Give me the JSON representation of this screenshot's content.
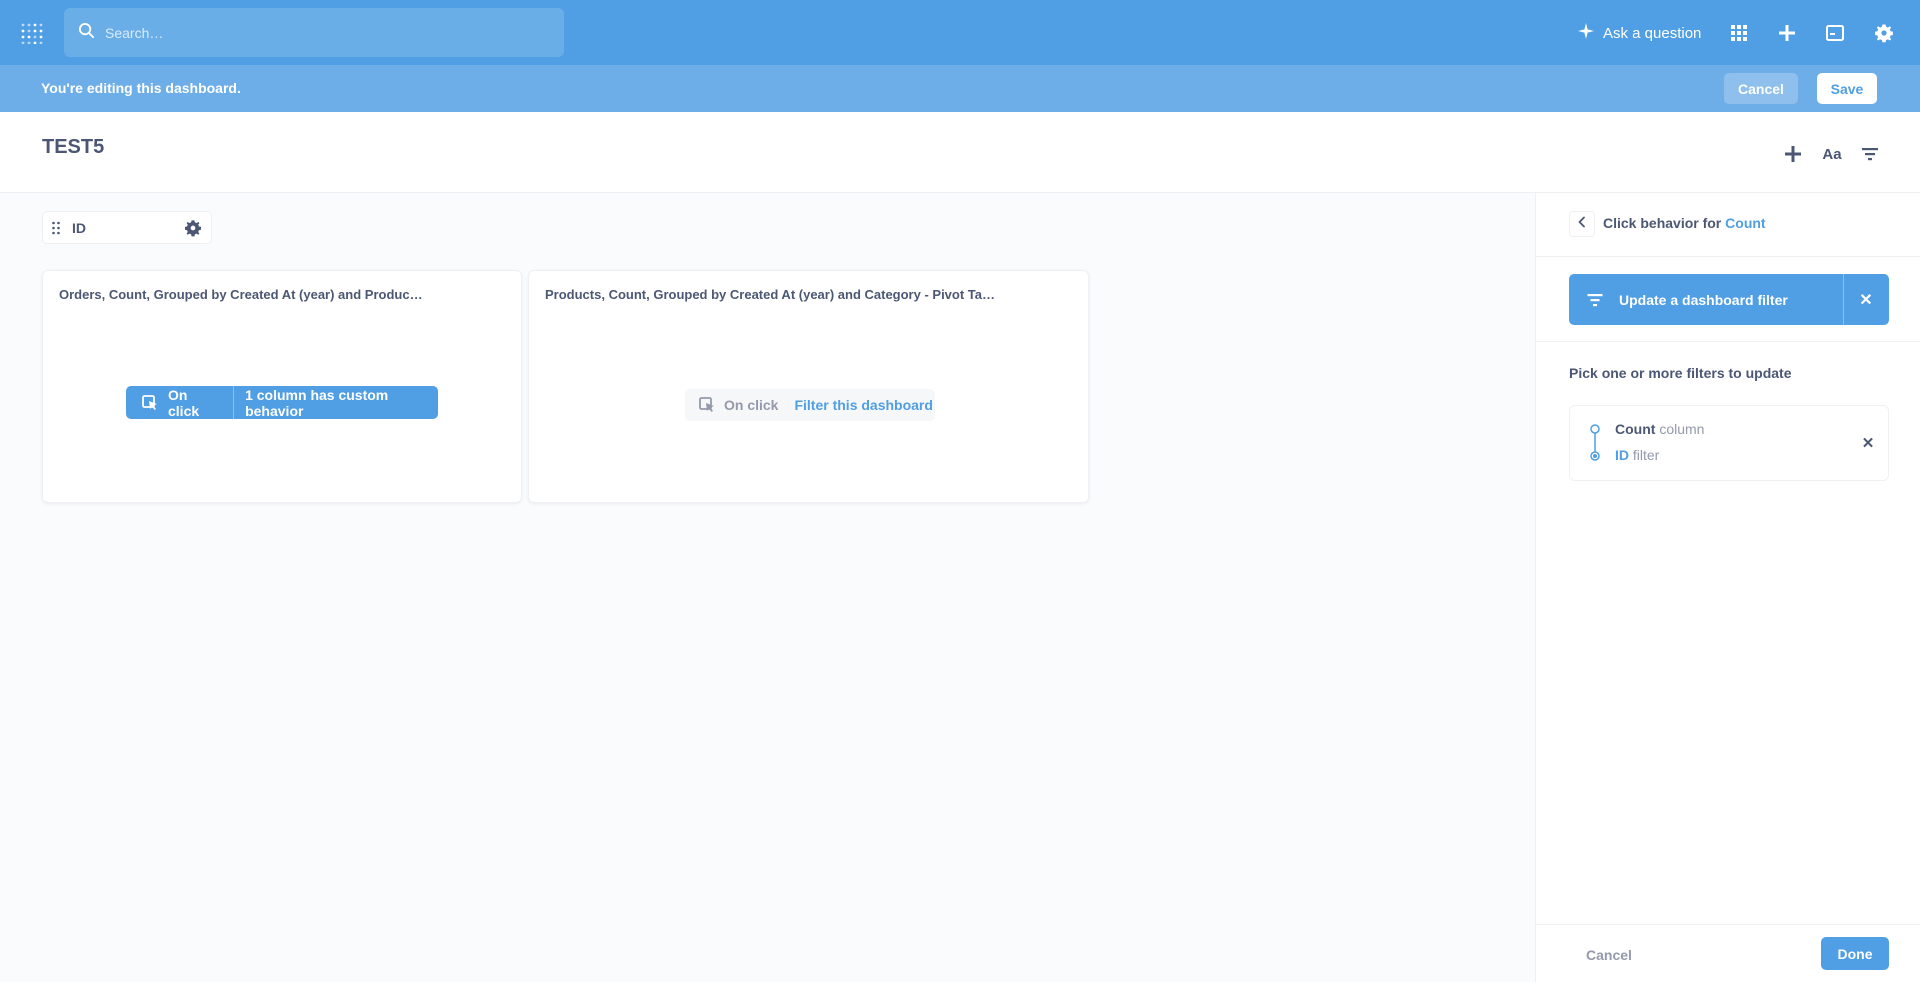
{
  "topnav": {
    "search_placeholder": "Search…",
    "ask_label": "Ask a question",
    "icons": [
      "logo-icon",
      "search-icon",
      "sparkle-icon",
      "grid-icon",
      "plus-icon",
      "terminal-icon",
      "gear-icon"
    ],
    "colors": {
      "bar": "#509ee3"
    }
  },
  "editbar": {
    "message": "You're editing this dashboard.",
    "cancel_label": "Cancel",
    "save_label": "Save"
  },
  "dashboard": {
    "title": "TEST5",
    "header_icons": [
      "add-icon",
      "text-icon",
      "filter-icon"
    ],
    "text_icon_label": "Aa"
  },
  "filter": {
    "label": "ID"
  },
  "cards": [
    {
      "title": "Orders, Count, Grouped by Created At (year) and Produc…",
      "click_label": "On click",
      "click_value": "1 column has custom behavior",
      "active": true
    },
    {
      "title": "Products, Count, Grouped by Created At (year) and Category - Pivot Ta…",
      "click_label": "On click",
      "click_value": "Filter this dashboard",
      "active": false
    }
  ],
  "sidebar": {
    "title_prefix": "Click behavior for",
    "title_column": "Count",
    "action_label": "Update a dashboard filter",
    "pick_label": "Pick one or more filters to update",
    "mapping": {
      "source_name": "Count",
      "source_type": "column",
      "target_name": "ID",
      "target_type": "filter"
    },
    "cancel_label": "Cancel",
    "done_label": "Done"
  },
  "colors": {
    "brand": "#509ee3",
    "text": "#4c5773",
    "muted": "#949aab"
  }
}
